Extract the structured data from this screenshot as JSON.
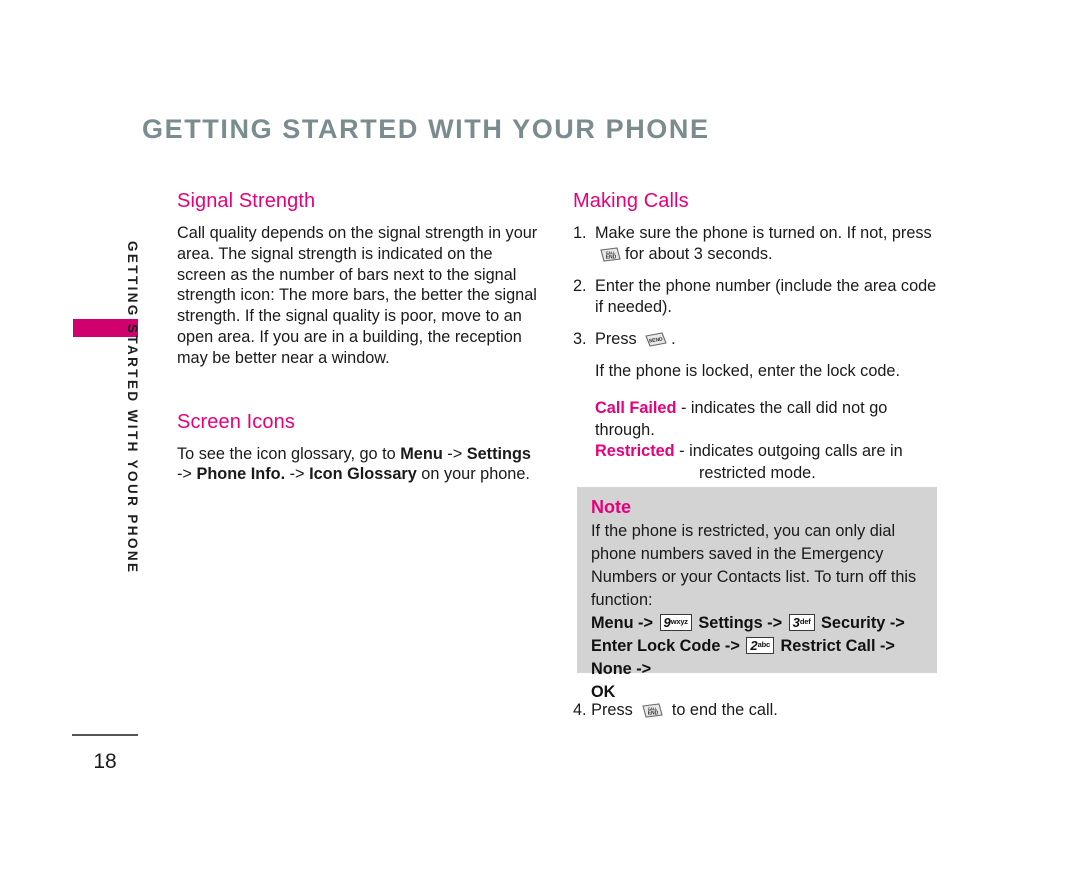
{
  "page": {
    "title": "GETTING STARTED WITH YOUR PHONE",
    "side_tab_label": "GETTING STARTED WITH YOUR PHONE",
    "page_number": "18",
    "accent_color": "#e6007e",
    "tab_color": "#d0006f",
    "title_color": "#7b8c90",
    "note_bg_color": "#d3d3d3"
  },
  "left_column": {
    "signal_strength": {
      "heading": "Signal Strength",
      "body": "Call quality depends on the signal strength in your area. The signal strength is indicated on the screen as the number of bars next to the signal strength icon: The more bars, the better the signal strength. If the signal quality is poor, move to an open area. If you are in a building, the reception may be better near a window."
    },
    "screen_icons": {
      "heading": "Screen Icons",
      "intro": "To see the icon glossary, go to ",
      "path_1": "Menu",
      "arrow_1": " -> ",
      "path_2": "Settings",
      "arrow_2": " -> ",
      "path_3": "Phone Info.",
      "arrow_3": " -> ",
      "path_4": "Icon Glossary",
      "outro": " on your phone."
    }
  },
  "right_column": {
    "heading": "Making Calls",
    "steps": [
      {
        "num": "1.",
        "text_before": "Make sure the phone is turned on. If not, press",
        "icon": "end-key-icon",
        "icon_label": "END",
        "text_after": "for about 3 seconds."
      },
      {
        "num": "2.",
        "text_before": "Enter the phone number (include the area code if needed).",
        "icon": null,
        "icon_label": "",
        "text_after": ""
      },
      {
        "num": "3.",
        "text_before": "Press",
        "icon": "send-key-icon",
        "icon_label": "SEND",
        "text_after": "."
      }
    ],
    "locked_note": "If the phone is locked, enter the lock code.",
    "indicators": [
      {
        "term": "Call Failed",
        "separator": " - ",
        "description": "indicates the call did not go through.",
        "continuation": ""
      },
      {
        "term": "Restricted",
        "separator": " - ",
        "description": "indicates outgoing calls are in",
        "continuation": "restricted mode."
      }
    ],
    "final_step": {
      "num": "4.",
      "text_before": "Press",
      "icon": "end-key-icon",
      "icon_label": "END",
      "text_after": "to end the call."
    }
  },
  "note": {
    "title": "Note",
    "body": "If the phone is restricted, you can only dial phone numbers saved in the Emergency Numbers or your Contacts list. To turn off this function:",
    "path": {
      "menu": "Menu",
      "arrow_1": " -> ",
      "key_9_digit": "9",
      "key_9_letters": "wxyz",
      "settings": "Settings",
      "arrow_2": " -> ",
      "key_3_digit": "3",
      "key_3_letters": "def",
      "security": "Security",
      "arrow_3": " -> ",
      "enter_lock_code": "Enter Lock Code",
      "arrow_4": " -> ",
      "key_2_digit": "2",
      "key_2_letters": "abc",
      "restrict_call": "Restrict Call",
      "arrow_5": " -> ",
      "none": "None",
      "arrow_6": " -> ",
      "ok": "OK"
    }
  }
}
